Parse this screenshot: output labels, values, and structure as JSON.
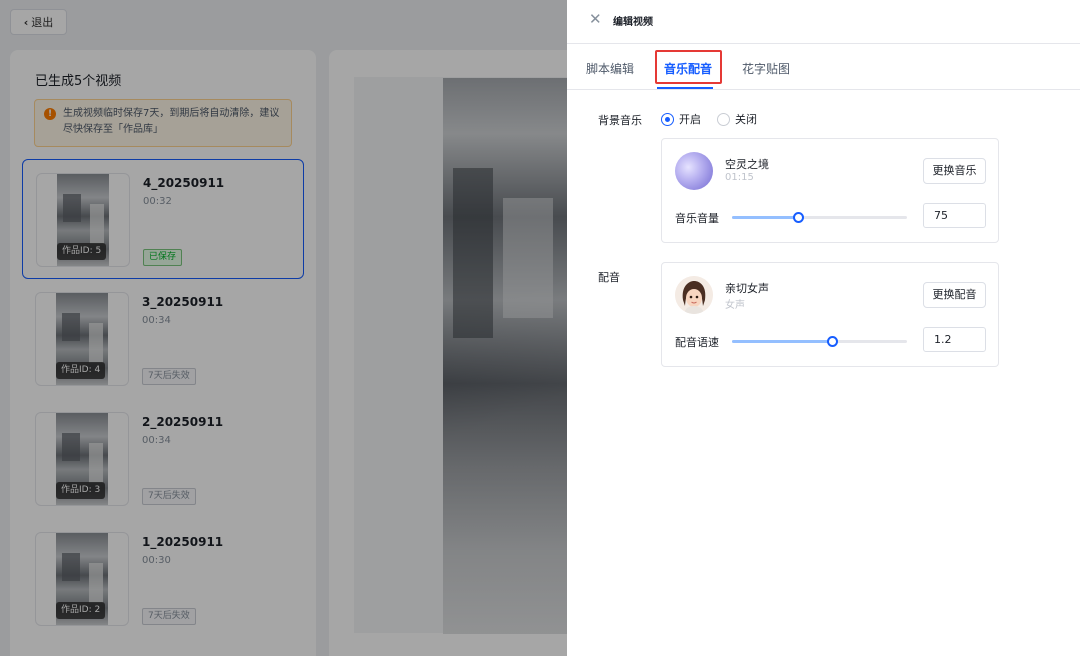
{
  "page": {
    "back_label": "退出",
    "generated_title": "已生成5个视频",
    "notice_text": "生成视频临时保存7天，到期后将自动清除，建议尽快保存至「作品库」",
    "videos": [
      {
        "name": "4_20250911",
        "duration": "00:32",
        "product_id": "作品ID: 5",
        "status": "已保存",
        "status_type": "saved"
      },
      {
        "name": "3_20250911",
        "duration": "00:34",
        "product_id": "作品ID: 4",
        "status": "7天后失效",
        "status_type": "expire"
      },
      {
        "name": "2_20250911",
        "duration": "00:34",
        "product_id": "作品ID: 3",
        "status": "7天后失效",
        "status_type": "expire"
      },
      {
        "name": "1_20250911",
        "duration": "00:30",
        "product_id": "作品ID: 2",
        "status": "7天后失效",
        "status_type": "expire"
      }
    ]
  },
  "drawer": {
    "title": "编辑视频",
    "tabs": [
      {
        "label": "脚本编辑",
        "active": false
      },
      {
        "label": "音乐配音",
        "active": true
      },
      {
        "label": "花字贴图",
        "active": false
      }
    ],
    "bgm": {
      "label": "背景音乐",
      "options": [
        {
          "label": "开启",
          "selected": true
        },
        {
          "label": "关闭",
          "selected": false
        }
      ],
      "track_name": "空灵之境",
      "track_duration": "01:15",
      "change_button": "更换音乐",
      "volume_label": "音乐音量",
      "volume_value": "75",
      "volume_fraction": 0.375
    },
    "voice": {
      "label": "配音",
      "voice_name": "亲切女声",
      "voice_gender": "女声",
      "change_button": "更换配音",
      "speed_label": "配音语速",
      "speed_value": "1.2",
      "speed_fraction": 0.57
    }
  },
  "colors": {
    "accent": "#165dff",
    "highlight_border": "#e53935",
    "warning": "#ff7d00",
    "saved_green": "#00b42a"
  },
  "icons": {
    "back": "chevron-left-icon",
    "close": "close-icon",
    "notice": "warning-icon"
  }
}
